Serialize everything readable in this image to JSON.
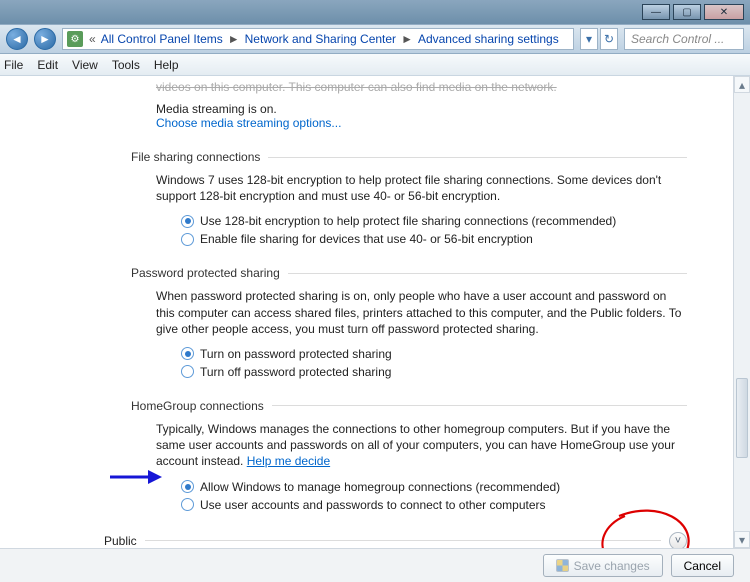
{
  "window": {
    "title_partial": "",
    "buttons": {
      "min": "—",
      "max": "▢",
      "close": "✕"
    }
  },
  "nav": {
    "back": "◄",
    "forward": "►",
    "crumbs": [
      "All Control Panel Items",
      "Network and Sharing Center",
      "Advanced sharing settings"
    ],
    "sep": "►",
    "dropdown": "▾",
    "refresh": "↻",
    "search_placeholder": "Search Control ..."
  },
  "menu": [
    "File",
    "Edit",
    "View",
    "Tools",
    "Help"
  ],
  "content": {
    "top_trunc": "videos on this computer. This computer can also find media on the network.",
    "media_on": "Media streaming is on.",
    "media_link": "Choose media streaming options...",
    "sections": {
      "file_sharing": {
        "title": "File sharing connections",
        "desc": "Windows 7 uses 128-bit encryption to help protect file sharing connections. Some devices don't support 128-bit encryption and must use 40- or 56-bit encryption.",
        "opts": [
          "Use 128-bit encryption to help protect file sharing connections (recommended)",
          "Enable file sharing for devices that use 40- or 56-bit encryption"
        ],
        "selected": 0
      },
      "password": {
        "title": "Password protected sharing",
        "desc": "When password protected sharing is on, only people who have a user account and password on this computer can access shared files, printers attached to this computer, and the Public folders. To give other people access, you must turn off password protected sharing.",
        "opts": [
          "Turn on password protected sharing",
          "Turn off password protected sharing"
        ],
        "selected": 0
      },
      "homegroup": {
        "title": "HomeGroup connections",
        "desc_a": "Typically, Windows manages the connections to other homegroup computers. But if you have the same user accounts and passwords on all of your computers, you can have HomeGroup use your account instead. ",
        "desc_link": "Help me decide",
        "opts": [
          "Allow Windows to manage homegroup connections (recommended)",
          "Use user accounts and passwords to connect to other computers"
        ],
        "selected": 0
      }
    },
    "public": {
      "label": "Public",
      "chevron": "˅"
    }
  },
  "footer": {
    "save": "Save changes",
    "cancel": "Cancel"
  }
}
